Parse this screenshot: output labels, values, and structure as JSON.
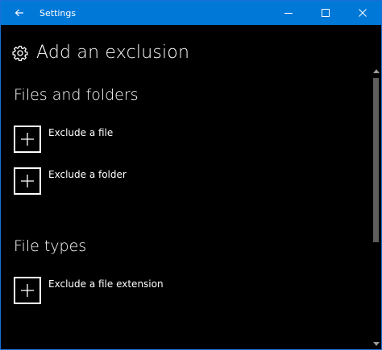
{
  "window": {
    "title": "Settings",
    "accent_color": "#0078d7"
  },
  "titlebar": {
    "back_icon": "arrow-left-icon",
    "minimize_icon": "minimize-icon",
    "maximize_icon": "maximize-icon",
    "close_icon": "close-icon"
  },
  "header": {
    "icon": "gear-icon",
    "title": "Add an exclusion"
  },
  "sections": [
    {
      "title": "Files and folders",
      "items": [
        {
          "label": "Exclude a file",
          "icon": "plus-icon"
        },
        {
          "label": "Exclude a folder",
          "icon": "plus-icon"
        }
      ]
    },
    {
      "title": "File types",
      "items": [
        {
          "label": "Exclude a file extension",
          "icon": "plus-icon"
        }
      ]
    }
  ]
}
